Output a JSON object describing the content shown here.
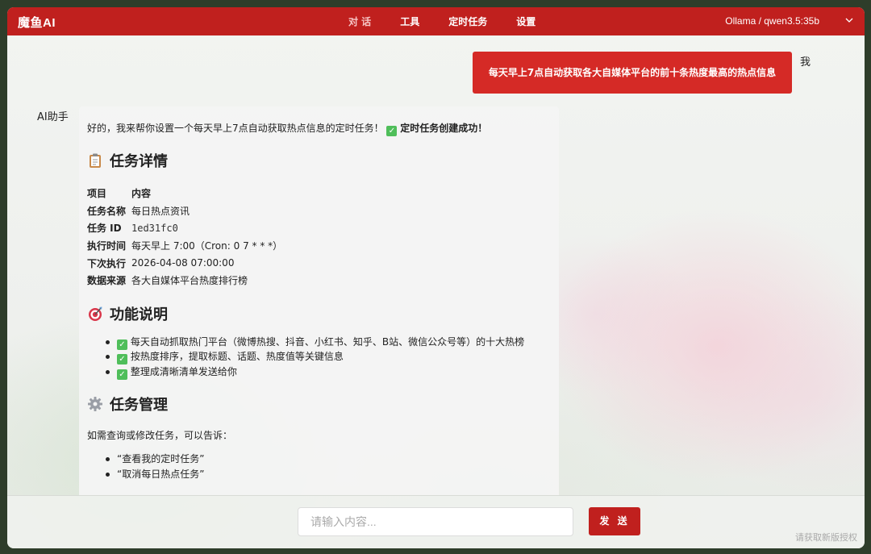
{
  "app": {
    "logo": "魔鱼AI",
    "model": "Ollama / qwen3.5:35b"
  },
  "nav": [
    {
      "label": "对 话",
      "active": true
    },
    {
      "label": "工具",
      "active": false
    },
    {
      "label": "定时任务",
      "active": false
    },
    {
      "label": "设置",
      "active": false
    }
  ],
  "chat": {
    "user": {
      "label": "我",
      "message": "每天早上7点自动获取各大自媒体平台的前十条热度最高的热点信息"
    },
    "ai": {
      "label": "AI助手",
      "intro": "好的，我来帮你设置一个每天早上7点自动获取热点信息的定时任务！",
      "success": "定时任务创建成功！",
      "details_title": "任务详情",
      "details_header": {
        "col1": "项目",
        "col2": "内容"
      },
      "details_rows": [
        {
          "key": "任务名称",
          "value": "每日热点资讯",
          "mono": false
        },
        {
          "key": "任务 ID",
          "value": "1ed31fc0",
          "mono": true
        },
        {
          "key": "执行时间",
          "value": "每天早上 7:00（Cron: 0 7 * * *）",
          "mono": false
        },
        {
          "key": "下次执行",
          "value": "2026-04-08 07:00:00",
          "mono": false
        },
        {
          "key": "数据来源",
          "value": "各大自媒体平台热度排行榜",
          "mono": false
        }
      ],
      "features_title": "功能说明",
      "features": [
        "每天自动抓取热门平台（微博热搜、抖音、小红书、知乎、B站、微信公众号等）的十大热榜",
        "按热度排序，提取标题、话题、热度值等关键信息",
        "整理成清晰清单发送给你"
      ],
      "manage_title": "任务管理",
      "manage_text": "如需查询或修改任务，可以告诉：",
      "manage_items": [
        "“查看我的定时任务”",
        "“取消每日热点任务”"
      ]
    }
  },
  "composer": {
    "placeholder": "请输入内容...",
    "send_label": "发 送"
  },
  "footer": {
    "license_link": "请获取新版授权"
  },
  "colors": {
    "brand_red": "#c0201e",
    "user_bubble": "#d52a26",
    "check_green": "#4fbe5a"
  },
  "icons": {
    "success": "check-box-icon",
    "details": "clipboard-icon",
    "features": "target-icon",
    "manage": "gear-icon",
    "model_dropdown": "chevron-down-icon"
  }
}
